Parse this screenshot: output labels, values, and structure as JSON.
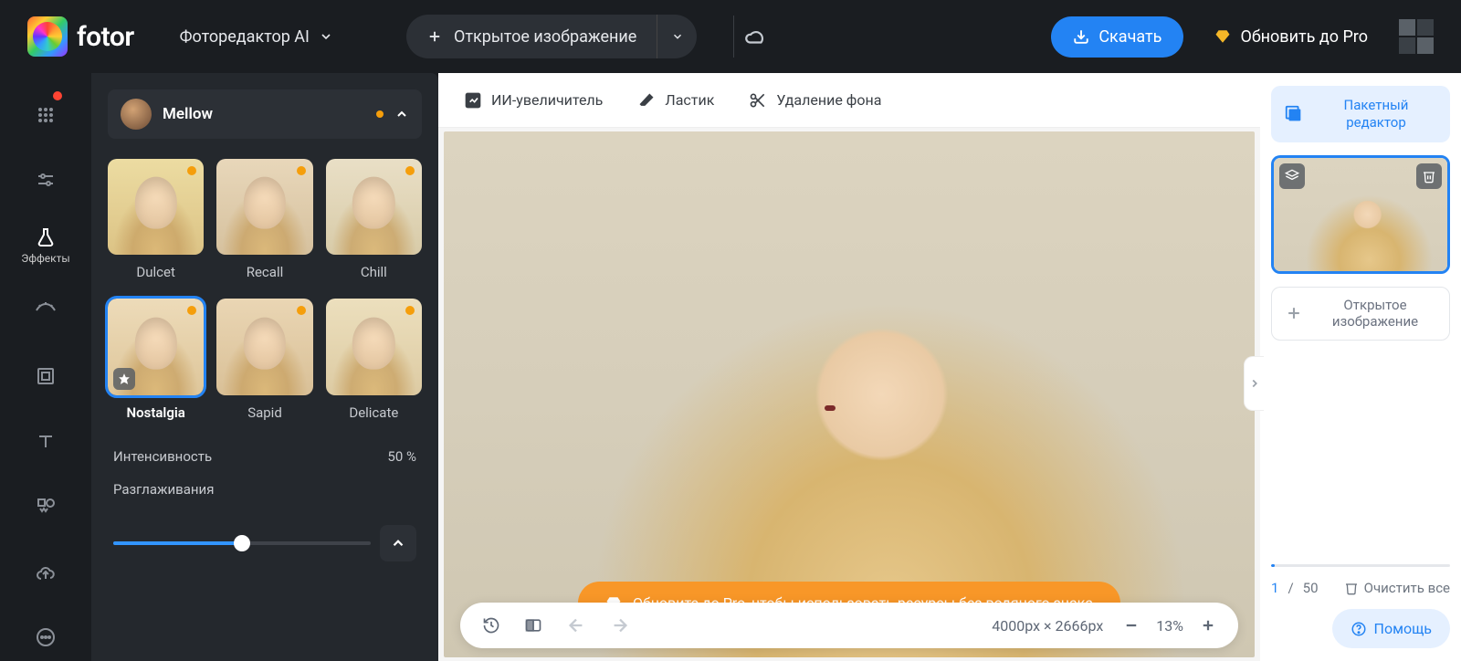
{
  "brand": {
    "name": "fotor"
  },
  "header": {
    "mode_label": "Фоторедактор AI",
    "open_image_label": "Открытое изображение",
    "download_label": "Скачать",
    "upgrade_label": "Обновить до Pro"
  },
  "rail": {
    "effects_label": "Эффекты"
  },
  "effects_panel": {
    "category_title": "Mellow",
    "items": [
      {
        "id": "dulcet",
        "label": "Dulcet",
        "pro": true,
        "selected": false
      },
      {
        "id": "recall",
        "label": "Recall",
        "pro": true,
        "selected": false
      },
      {
        "id": "chill",
        "label": "Chill",
        "pro": true,
        "selected": false
      },
      {
        "id": "nostalgia",
        "label": "Nostalgia",
        "pro": true,
        "selected": true,
        "favorite": true
      },
      {
        "id": "sapid",
        "label": "Sapid",
        "pro": true,
        "selected": false
      },
      {
        "id": "delicate",
        "label": "Delicate",
        "pro": true,
        "selected": false
      }
    ],
    "intensity_label": "Интенсивность",
    "intensity_value": "50 %",
    "smoothing_label": "Разглаживания",
    "smoothing_pct": 50
  },
  "canvas_toolbar": {
    "upscaler": "ИИ-увеличитель",
    "eraser": "Ластик",
    "bg_remove": "Удаление фона"
  },
  "canvas": {
    "watermark_cta": "Обновите до Pro, чтобы использовать ресурсы без водяного знака",
    "dimensions": "4000px × 2666px",
    "zoom": "13%"
  },
  "right_rail": {
    "batch_label": "Пакетный\nредактор",
    "open_image_label": "Открытое\nизображение",
    "page_current": "1",
    "page_total": "50",
    "page_sep": "/",
    "clear_all": "Очистить все",
    "help": "Помощь"
  }
}
